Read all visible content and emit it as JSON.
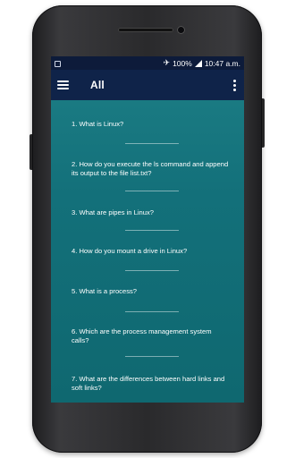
{
  "status_bar": {
    "battery": "100%",
    "time": "10:47 a.m.",
    "icons": [
      "screenshot-icon",
      "airplane-icon",
      "signal-icon",
      "battery-icon"
    ]
  },
  "app_bar": {
    "title": "All",
    "icons": [
      "menu-icon",
      "more-vert-icon"
    ]
  },
  "questions": [
    "1. What is Linux?",
    "2. How do you execute the ls command and append its output to the file list.txt?",
    "3. What are pipes in Linux?",
    "4. How do you mount a drive in Linux?",
    "5. What is a process?",
    "6. Which are the process management system calls?",
    "7. What are the differences between hard links and soft links?"
  ],
  "colors": {
    "status_bar": "#0d1b3a",
    "app_bar": "#0f2349",
    "background": "#13707a"
  }
}
